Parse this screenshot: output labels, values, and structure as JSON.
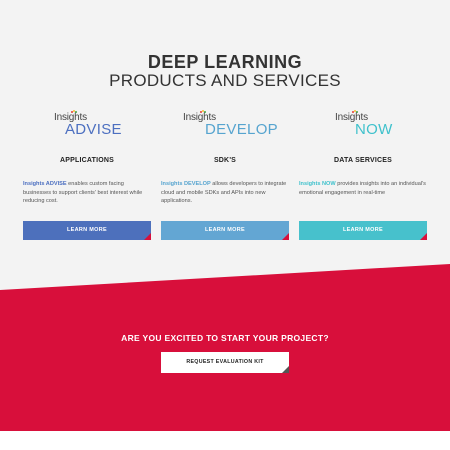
{
  "hero": {
    "title_line1": "DEEP LEARNING",
    "title_line2": "PRODUCTS AND SERVICES"
  },
  "products": [
    {
      "logo_small": "Insights",
      "logo_big": "ADVISE",
      "title": "APPLICATIONS",
      "desc_brand": "Insights ADVISE",
      "desc_text": " enables custom facing businesses to support clients' best interest while reducing cost.",
      "button": "LEARN MORE",
      "color": "#4d70bc"
    },
    {
      "logo_small": "Insights",
      "logo_big": "DEVELOP",
      "title": "SDK'S",
      "desc_brand": "Insights DEVELOP",
      "desc_text": " allows developers to integrate cloud and mobile SDKs and APIs into new applications.",
      "button": "LEARN MORE",
      "color": "#63a6d3"
    },
    {
      "logo_small": "Insights",
      "logo_big": "NOW",
      "title": "DATA SERVICES",
      "desc_brand": "Insights NOW",
      "desc_text": " provides insights into an individual's emotional engagement in real-time",
      "button": "LEARN MORE",
      "color": "#47c1cc"
    }
  ],
  "cta": {
    "title": "ARE YOU EXCITED TO START YOUR PROJECT?",
    "button": "REQUEST EVALUATION KIT",
    "background": "#d80f3b"
  },
  "icons": [
    "corner-triangle-icon",
    "insights-dots-icon"
  ]
}
